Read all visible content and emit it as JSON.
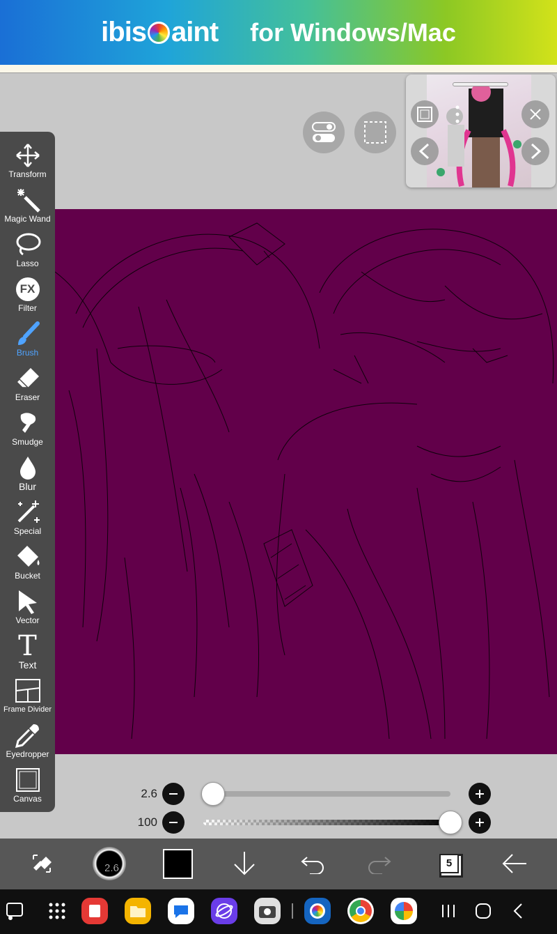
{
  "banner": {
    "brand_prefix": "ibis",
    "brand_suffix": "aint",
    "platform_text": "for Windows/Mac"
  },
  "tools": [
    {
      "label": "Transform",
      "icon": "move-arrows-icon"
    },
    {
      "label": "Magic Wand",
      "icon": "magic-wand-icon"
    },
    {
      "label": "Lasso",
      "icon": "lasso-icon"
    },
    {
      "label": "Filter",
      "icon": "fx-icon",
      "glyph": "FX"
    },
    {
      "label": "Brush",
      "icon": "brush-icon",
      "active": true
    },
    {
      "label": "Eraser",
      "icon": "eraser-icon"
    },
    {
      "label": "Smudge",
      "icon": "smudge-icon"
    },
    {
      "label": "Blur",
      "icon": "blur-drop-icon"
    },
    {
      "label": "Special",
      "icon": "special-sparkle-icon"
    },
    {
      "label": "Bucket",
      "icon": "bucket-icon"
    },
    {
      "label": "Vector",
      "icon": "vector-arrow-icon"
    },
    {
      "label": "Text",
      "icon": "text-icon",
      "glyph": "T"
    },
    {
      "label": "Frame Divider",
      "icon": "frame-divider-icon"
    },
    {
      "label": "Eyedropper",
      "icon": "eyedropper-icon"
    },
    {
      "label": "Canvas",
      "icon": "canvas-icon"
    }
  ],
  "brush_size": {
    "value": "2.6",
    "level": 0.02
  },
  "brush_opacity": {
    "value": "100",
    "level": 1.0
  },
  "bottom_bar": {
    "brush_size_label": "2.6",
    "layer_count": "5",
    "color": "#000000"
  },
  "canvas": {
    "background_color": "#62004a"
  },
  "colors": {
    "toolbar_bg": "#4a4a4a",
    "active_tool": "#4fa3ff",
    "bottom_bar_bg": "#575757"
  }
}
